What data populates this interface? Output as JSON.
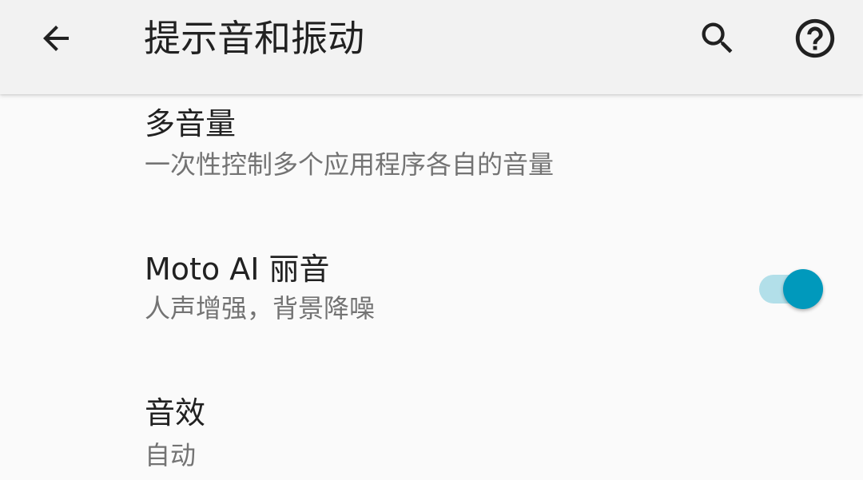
{
  "header": {
    "title": "提示音和振动",
    "back_icon": "arrow-back-icon",
    "search_icon": "search-icon",
    "help_icon": "help-circle-icon"
  },
  "settings": [
    {
      "title": "多音量",
      "summary": "一次性控制多个应用程序各自的音量"
    },
    {
      "title": "Moto AI 丽音",
      "summary": "人声增强，背景降噪",
      "toggle_on": true
    },
    {
      "title": "音效",
      "summary": "自动"
    }
  ],
  "colors": {
    "accent": "#0099bc",
    "toggle_track": "#b2dfe9",
    "appbar_bg": "#f2f2f2",
    "background": "#fafafa",
    "title_text": "#212121",
    "summary_text": "#737373"
  }
}
